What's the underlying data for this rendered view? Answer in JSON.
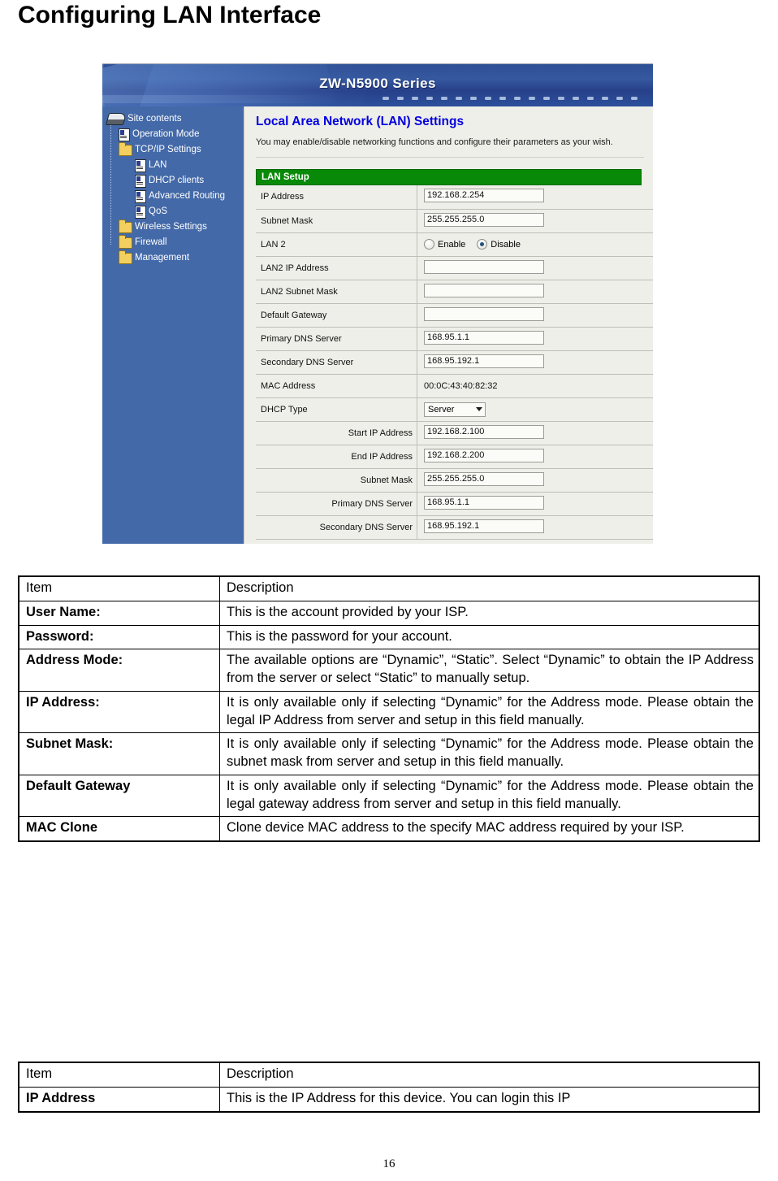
{
  "page": {
    "title": "Configuring LAN Interface",
    "number": "16"
  },
  "router_screenshot": {
    "banner_title": "ZW-N5900 Series",
    "sidebar": {
      "items": [
        {
          "label": "Site contents",
          "icon": "site-contents-icon",
          "level": 0
        },
        {
          "label": "Operation Mode",
          "icon": "document-icon",
          "level": 1
        },
        {
          "label": "TCP/IP Settings",
          "icon": "folder-icon",
          "level": 1
        },
        {
          "label": "LAN",
          "icon": "document-icon",
          "level": 2
        },
        {
          "label": "DHCP clients",
          "icon": "document-icon",
          "level": 2
        },
        {
          "label": "Advanced Routing",
          "icon": "document-icon",
          "level": 2
        },
        {
          "label": "QoS",
          "icon": "document-icon",
          "level": 2
        },
        {
          "label": "Wireless Settings",
          "icon": "folder-icon",
          "level": 1
        },
        {
          "label": "Firewall",
          "icon": "folder-icon",
          "level": 1
        },
        {
          "label": "Management",
          "icon": "folder-icon",
          "level": 1
        }
      ]
    },
    "content": {
      "heading": "Local Area Network (LAN) Settings",
      "description": "You may enable/disable networking functions and configure their parameters as your wish.",
      "section_title": "LAN Setup",
      "section_color": "#088a08",
      "rows": [
        {
          "label": "IP Address",
          "type": "textbox",
          "value": "192.168.2.254"
        },
        {
          "label": "Subnet Mask",
          "type": "textbox",
          "value": "255.255.255.0"
        },
        {
          "label": "LAN 2",
          "type": "radio",
          "options": [
            "Enable",
            "Disable"
          ],
          "selected": "Disable"
        },
        {
          "label": "LAN2 IP Address",
          "type": "textbox",
          "value": ""
        },
        {
          "label": "LAN2 Subnet Mask",
          "type": "textbox",
          "value": ""
        },
        {
          "label": "Default Gateway",
          "type": "textbox",
          "value": ""
        },
        {
          "label": "Primary DNS Server",
          "type": "textbox",
          "value": "168.95.1.1"
        },
        {
          "label": "Secondary DNS Server",
          "type": "textbox",
          "value": "168.95.192.1"
        },
        {
          "label": "MAC Address",
          "type": "text",
          "value": "00:0C:43:40:82:32"
        },
        {
          "label": "DHCP Type",
          "type": "select",
          "value": "Server"
        },
        {
          "label": "Start IP Address",
          "type": "textbox",
          "value": "192.168.2.100",
          "indent": true
        },
        {
          "label": "End IP Address",
          "type": "textbox",
          "value": "192.168.2.200",
          "indent": true
        },
        {
          "label": "Subnet Mask",
          "type": "textbox",
          "value": "255.255.255.0",
          "indent": true
        },
        {
          "label": "Primary DNS Server",
          "type": "textbox",
          "value": "168.95.1.1",
          "indent": true
        },
        {
          "label": "Secondary DNS Server",
          "type": "textbox",
          "value": "168.95.192.1",
          "indent": true
        }
      ]
    }
  },
  "table_one": {
    "header": {
      "item": "Item",
      "description": "Description"
    },
    "rows": [
      {
        "item": "User Name:",
        "description": "This is the account provided by your ISP."
      },
      {
        "item": "Password:",
        "description": "This is the password for your account."
      },
      {
        "item": "Address Mode:",
        "description": "The available options are “Dynamic”, “Static”. Select “Dynamic” to obtain the IP Address from the server or select “Static” to manually setup."
      },
      {
        "item": "IP Address:",
        "description": "It is only available only if selecting “Dynamic” for the Address mode. Please obtain the legal IP Address from server and setup in this field manually."
      },
      {
        "item": "Subnet Mask:",
        "description": "It is only available only if selecting “Dynamic” for the Address mode. Please obtain the subnet mask from server and setup in this field manually."
      },
      {
        "item": "Default Gateway",
        "description": "It is only available only if selecting “Dynamic” for the Address mode. Please obtain the legal gateway address from server and setup in this field manually."
      },
      {
        "item": "MAC Clone",
        "description": "Clone device MAC address to the specify MAC address required by your ISP."
      }
    ]
  },
  "table_two": {
    "header": {
      "item": "Item",
      "description": "Description"
    },
    "rows": [
      {
        "item": "IP Address",
        "description": "This is the IP Address for this device. You can login this IP"
      }
    ]
  }
}
